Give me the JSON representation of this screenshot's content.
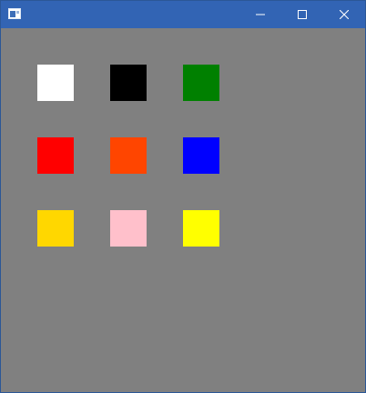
{
  "window": {
    "title": "",
    "titlebar_color": "#3264b4",
    "background_color": "#808080",
    "controls": {
      "minimize_icon": "minimize-icon",
      "maximize_icon": "maximize-icon",
      "close_icon": "close-icon"
    }
  },
  "swatches": [
    {
      "name": "white",
      "color": "#ffffff"
    },
    {
      "name": "black",
      "color": "#000000"
    },
    {
      "name": "green",
      "color": "#008000"
    },
    {
      "name": "red",
      "color": "#ff0000"
    },
    {
      "name": "orange-red",
      "color": "#ff4500"
    },
    {
      "name": "blue",
      "color": "#0000ff"
    },
    {
      "name": "gold",
      "color": "#ffd700"
    },
    {
      "name": "pink",
      "color": "#ffc0cb"
    },
    {
      "name": "yellow",
      "color": "#ffff00"
    }
  ]
}
